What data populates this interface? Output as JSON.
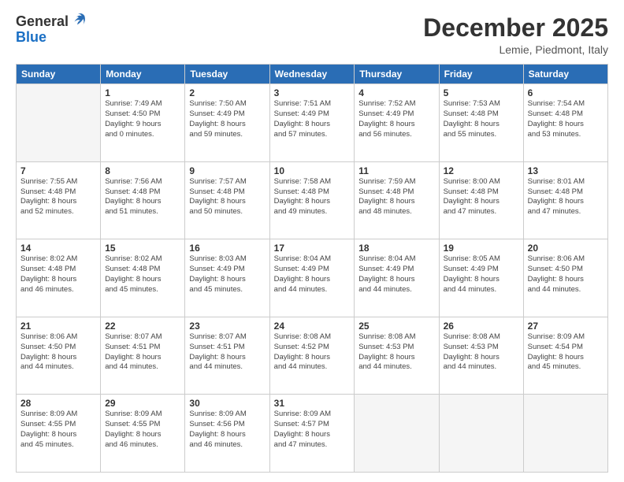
{
  "logo": {
    "general": "General",
    "blue": "Blue"
  },
  "header": {
    "month": "December 2025",
    "location": "Lemie, Piedmont, Italy"
  },
  "days_of_week": [
    "Sunday",
    "Monday",
    "Tuesday",
    "Wednesday",
    "Thursday",
    "Friday",
    "Saturday"
  ],
  "weeks": [
    [
      {
        "day": "",
        "info": ""
      },
      {
        "day": "1",
        "info": "Sunrise: 7:49 AM\nSunset: 4:50 PM\nDaylight: 9 hours\nand 0 minutes."
      },
      {
        "day": "2",
        "info": "Sunrise: 7:50 AM\nSunset: 4:49 PM\nDaylight: 8 hours\nand 59 minutes."
      },
      {
        "day": "3",
        "info": "Sunrise: 7:51 AM\nSunset: 4:49 PM\nDaylight: 8 hours\nand 57 minutes."
      },
      {
        "day": "4",
        "info": "Sunrise: 7:52 AM\nSunset: 4:49 PM\nDaylight: 8 hours\nand 56 minutes."
      },
      {
        "day": "5",
        "info": "Sunrise: 7:53 AM\nSunset: 4:48 PM\nDaylight: 8 hours\nand 55 minutes."
      },
      {
        "day": "6",
        "info": "Sunrise: 7:54 AM\nSunset: 4:48 PM\nDaylight: 8 hours\nand 53 minutes."
      }
    ],
    [
      {
        "day": "7",
        "info": "Sunrise: 7:55 AM\nSunset: 4:48 PM\nDaylight: 8 hours\nand 52 minutes."
      },
      {
        "day": "8",
        "info": "Sunrise: 7:56 AM\nSunset: 4:48 PM\nDaylight: 8 hours\nand 51 minutes."
      },
      {
        "day": "9",
        "info": "Sunrise: 7:57 AM\nSunset: 4:48 PM\nDaylight: 8 hours\nand 50 minutes."
      },
      {
        "day": "10",
        "info": "Sunrise: 7:58 AM\nSunset: 4:48 PM\nDaylight: 8 hours\nand 49 minutes."
      },
      {
        "day": "11",
        "info": "Sunrise: 7:59 AM\nSunset: 4:48 PM\nDaylight: 8 hours\nand 48 minutes."
      },
      {
        "day": "12",
        "info": "Sunrise: 8:00 AM\nSunset: 4:48 PM\nDaylight: 8 hours\nand 47 minutes."
      },
      {
        "day": "13",
        "info": "Sunrise: 8:01 AM\nSunset: 4:48 PM\nDaylight: 8 hours\nand 47 minutes."
      }
    ],
    [
      {
        "day": "14",
        "info": "Sunrise: 8:02 AM\nSunset: 4:48 PM\nDaylight: 8 hours\nand 46 minutes."
      },
      {
        "day": "15",
        "info": "Sunrise: 8:02 AM\nSunset: 4:48 PM\nDaylight: 8 hours\nand 45 minutes."
      },
      {
        "day": "16",
        "info": "Sunrise: 8:03 AM\nSunset: 4:49 PM\nDaylight: 8 hours\nand 45 minutes."
      },
      {
        "day": "17",
        "info": "Sunrise: 8:04 AM\nSunset: 4:49 PM\nDaylight: 8 hours\nand 44 minutes."
      },
      {
        "day": "18",
        "info": "Sunrise: 8:04 AM\nSunset: 4:49 PM\nDaylight: 8 hours\nand 44 minutes."
      },
      {
        "day": "19",
        "info": "Sunrise: 8:05 AM\nSunset: 4:49 PM\nDaylight: 8 hours\nand 44 minutes."
      },
      {
        "day": "20",
        "info": "Sunrise: 8:06 AM\nSunset: 4:50 PM\nDaylight: 8 hours\nand 44 minutes."
      }
    ],
    [
      {
        "day": "21",
        "info": "Sunrise: 8:06 AM\nSunset: 4:50 PM\nDaylight: 8 hours\nand 44 minutes."
      },
      {
        "day": "22",
        "info": "Sunrise: 8:07 AM\nSunset: 4:51 PM\nDaylight: 8 hours\nand 44 minutes."
      },
      {
        "day": "23",
        "info": "Sunrise: 8:07 AM\nSunset: 4:51 PM\nDaylight: 8 hours\nand 44 minutes."
      },
      {
        "day": "24",
        "info": "Sunrise: 8:08 AM\nSunset: 4:52 PM\nDaylight: 8 hours\nand 44 minutes."
      },
      {
        "day": "25",
        "info": "Sunrise: 8:08 AM\nSunset: 4:53 PM\nDaylight: 8 hours\nand 44 minutes."
      },
      {
        "day": "26",
        "info": "Sunrise: 8:08 AM\nSunset: 4:53 PM\nDaylight: 8 hours\nand 44 minutes."
      },
      {
        "day": "27",
        "info": "Sunrise: 8:09 AM\nSunset: 4:54 PM\nDaylight: 8 hours\nand 45 minutes."
      }
    ],
    [
      {
        "day": "28",
        "info": "Sunrise: 8:09 AM\nSunset: 4:55 PM\nDaylight: 8 hours\nand 45 minutes."
      },
      {
        "day": "29",
        "info": "Sunrise: 8:09 AM\nSunset: 4:55 PM\nDaylight: 8 hours\nand 46 minutes."
      },
      {
        "day": "30",
        "info": "Sunrise: 8:09 AM\nSunset: 4:56 PM\nDaylight: 8 hours\nand 46 minutes."
      },
      {
        "day": "31",
        "info": "Sunrise: 8:09 AM\nSunset: 4:57 PM\nDaylight: 8 hours\nand 47 minutes."
      },
      {
        "day": "",
        "info": ""
      },
      {
        "day": "",
        "info": ""
      },
      {
        "day": "",
        "info": ""
      }
    ]
  ]
}
